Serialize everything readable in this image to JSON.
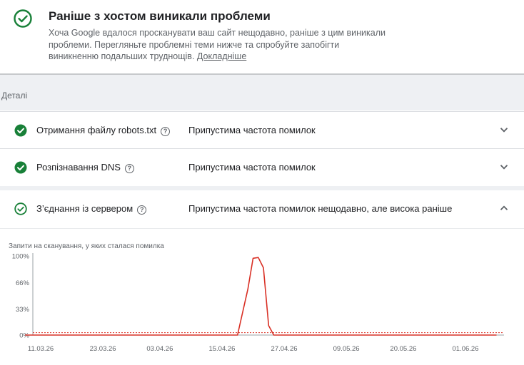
{
  "header": {
    "title": "Раніше з хостом виникали проблеми",
    "description": "Хоча Google вдалося просканувати ваш сайт нещодавно, раніше з цим виникали проблеми. Перегляньте проблемні теми нижче та спробуйте запобігти виникненню подальших труднощів.",
    "learn_more": "Докладніше",
    "icon": "check-circle-outline-icon",
    "accent_color": "#188038"
  },
  "details": {
    "label": "Деталі"
  },
  "rows": [
    {
      "name": "Отримання файлу robots.txt",
      "status": "Припустима частота помилок",
      "expanded": false
    },
    {
      "name": "Розпізнавання DNS",
      "status": "Припустима частота помилок",
      "expanded": false
    },
    {
      "name": "З’єднання із сервером",
      "status": "Припустима частота помилок нещодавно, але висока раніше",
      "expanded": true
    }
  ],
  "chart": {
    "title": "Запити на сканування, у яких сталася помилка"
  },
  "chart_data": {
    "type": "line",
    "title": "Запити на сканування, у яких сталася помилка",
    "y_ticks": [
      "100%",
      "66%",
      "33%",
      "0%"
    ],
    "x_ticks": [
      "11.03.26",
      "23.03.26",
      "03.04.26",
      "15.04.26",
      "27.04.26",
      "09.05.26",
      "20.05.26",
      "01.06.26"
    ],
    "ylim": [
      0,
      100
    ],
    "threshold": 3,
    "series": [
      {
        "color": "#d93025",
        "x": [
          "08.03.26",
          "18.04.26",
          "20.04.26",
          "21.04.26",
          "22.04.26",
          "23.04.26",
          "24.04.26",
          "25.04.26",
          "07.06.26"
        ],
        "values": [
          0,
          0,
          58,
          97,
          98,
          85,
          12,
          0,
          0
        ]
      }
    ]
  }
}
